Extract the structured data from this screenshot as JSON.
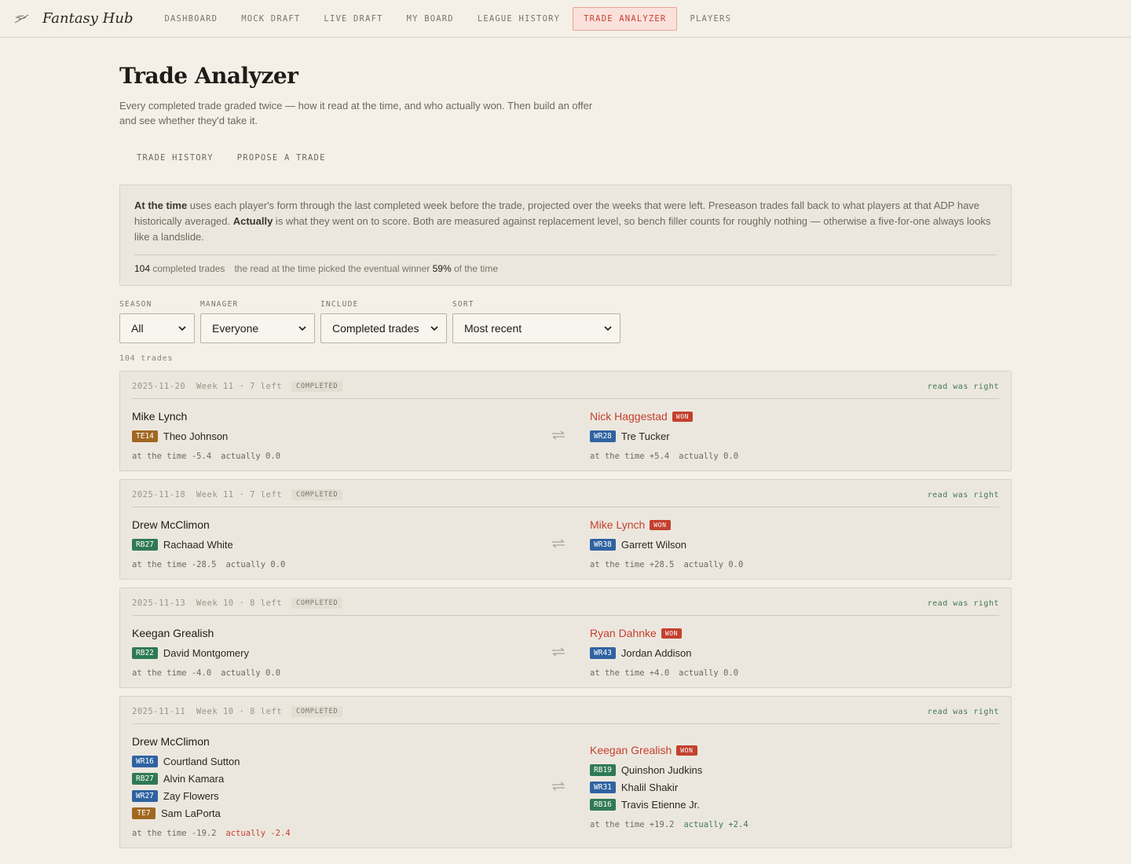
{
  "nav": {
    "brand": "Fantasy Hub",
    "links": [
      "DASHBOARD",
      "MOCK DRAFT",
      "LIVE DRAFT",
      "MY BOARD",
      "LEAGUE HISTORY",
      "TRADE ANALYZER",
      "PLAYERS"
    ],
    "active": "TRADE ANALYZER"
  },
  "page": {
    "title": "Trade Analyzer",
    "subtitle": "Every completed trade graded twice — how it read at the time, and who actually won. Then build an offer and see whether they'd take it.",
    "tabs": [
      "TRADE HISTORY",
      "PROPOSE A TRADE"
    ]
  },
  "explainer": {
    "lead1": "At the time",
    "text1": " uses each player's form through the last completed week before the trade, projected over the weeks that were left. Preseason trades fall back to what players at that ADP have historically averaged. ",
    "lead2": "Actually",
    "text2": " is what they went on to score. Both are measured against replacement level, so bench filler counts for roughly nothing — otherwise a five-for-one always looks like a landslide.",
    "stat_count": "104",
    "stat_count_label": "completed trades",
    "stat_acc_pre": "the read at the time picked the eventual winner",
    "stat_acc": "59%",
    "stat_acc_post": "of the time"
  },
  "filters": {
    "season": {
      "label": "SEASON",
      "value": "All"
    },
    "manager": {
      "label": "MANAGER",
      "value": "Everyone"
    },
    "include": {
      "label": "INCLUDE",
      "value": "Completed trades"
    },
    "sort": {
      "label": "SORT",
      "value": "Most recent"
    }
  },
  "count_line": "104 trades",
  "trades": [
    {
      "date": "2025-11-20",
      "week": "Week 11 · 7 left",
      "status": "COMPLETED",
      "verdict": "read was right",
      "left": {
        "manager": "Mike Lynch",
        "won": false,
        "players": [
          {
            "pos": "TE",
            "rank": "TE14",
            "name": "Theo Johnson"
          }
        ],
        "at_time": "at the time -5.4",
        "actually": "actually 0.0",
        "actually_tone": "neutral"
      },
      "right": {
        "manager": "Nick Haggestad",
        "won": true,
        "players": [
          {
            "pos": "WR",
            "rank": "WR28",
            "name": "Tre Tucker"
          }
        ],
        "at_time": "at the time +5.4",
        "actually": "actually 0.0",
        "actually_tone": "neutral"
      }
    },
    {
      "date": "2025-11-18",
      "week": "Week 11 · 7 left",
      "status": "COMPLETED",
      "verdict": "read was right",
      "left": {
        "manager": "Drew McClimon",
        "won": false,
        "players": [
          {
            "pos": "RB",
            "rank": "RB27",
            "name": "Rachaad White"
          }
        ],
        "at_time": "at the time -28.5",
        "actually": "actually 0.0",
        "actually_tone": "neutral"
      },
      "right": {
        "manager": "Mike Lynch",
        "won": true,
        "players": [
          {
            "pos": "WR",
            "rank": "WR38",
            "name": "Garrett Wilson"
          }
        ],
        "at_time": "at the time +28.5",
        "actually": "actually 0.0",
        "actually_tone": "neutral"
      }
    },
    {
      "date": "2025-11-13",
      "week": "Week 10 · 8 left",
      "status": "COMPLETED",
      "verdict": "read was right",
      "left": {
        "manager": "Keegan Grealish",
        "won": false,
        "players": [
          {
            "pos": "RB",
            "rank": "RB22",
            "name": "David Montgomery"
          }
        ],
        "at_time": "at the time -4.0",
        "actually": "actually 0.0",
        "actually_tone": "neutral"
      },
      "right": {
        "manager": "Ryan Dahnke",
        "won": true,
        "players": [
          {
            "pos": "WR",
            "rank": "WR43",
            "name": "Jordan Addison"
          }
        ],
        "at_time": "at the time +4.0",
        "actually": "actually 0.0",
        "actually_tone": "neutral"
      }
    },
    {
      "date": "2025-11-11",
      "week": "Week 10 · 8 left",
      "status": "COMPLETED",
      "verdict": "read was right",
      "left": {
        "manager": "Drew McClimon",
        "won": false,
        "players": [
          {
            "pos": "WR",
            "rank": "WR16",
            "name": "Courtland Sutton"
          },
          {
            "pos": "RB",
            "rank": "RB27",
            "name": "Alvin Kamara"
          },
          {
            "pos": "WR",
            "rank": "WR27",
            "name": "Zay Flowers"
          },
          {
            "pos": "TE",
            "rank": "TE7",
            "name": "Sam LaPorta"
          }
        ],
        "at_time": "at the time -19.2",
        "actually": "actually -2.4",
        "actually_tone": "neg"
      },
      "right": {
        "manager": "Keegan Grealish",
        "won": true,
        "players": [
          {
            "pos": "RB",
            "rank": "RB19",
            "name": "Quinshon Judkins"
          },
          {
            "pos": "WR",
            "rank": "WR31",
            "name": "Khalil Shakir"
          },
          {
            "pos": "RB",
            "rank": "RB16",
            "name": "Travis Etienne Jr."
          }
        ],
        "at_time": "at the time +19.2",
        "actually": "actually +2.4",
        "actually_tone": "pos"
      }
    }
  ],
  "won_label": "WON",
  "icons": {
    "brand": "feather-logo-icon",
    "swap": "swap-arrows-icon",
    "chevron": "chevron-down-icon"
  },
  "colors": {
    "accent": "#c4402f",
    "te": "#a06820",
    "wr": "#2f63a1",
    "rb": "#2f7a54",
    "good": "#3f7a55"
  }
}
